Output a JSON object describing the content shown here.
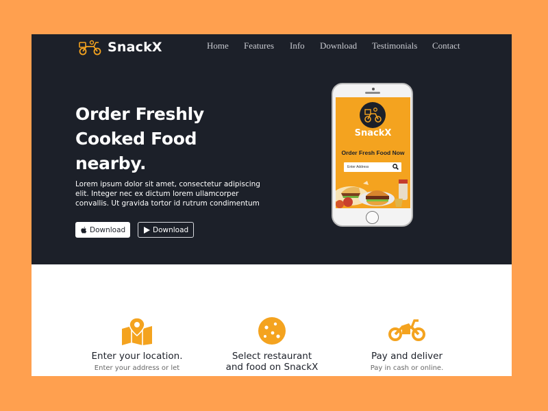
{
  "brand": {
    "name": "SnackX",
    "accent": "#F4A31F",
    "dark": "#1C2029",
    "background": "#FFA04F"
  },
  "nav": {
    "items": [
      "Home",
      "Features",
      "Info",
      "Download",
      "Testimonials",
      "Contact"
    ]
  },
  "hero": {
    "headline_lines": [
      "Order Freshly",
      "Cooked Food",
      "nearby."
    ],
    "description_lines": [
      "Lorem ipsum dolor sit amet, consectetur adipiscing",
      "elit. Integer nec ex dictum lorem ullamcorper",
      "convallis. Ut gravida tortor id rutrum condimentum"
    ],
    "buttons": [
      {
        "label": "Download",
        "icon": "apple-icon"
      },
      {
        "label": "Download",
        "icon": "play-store-icon"
      }
    ]
  },
  "phone_app": {
    "app_name": "SnackX",
    "tagline": "Order Fresh Food Now",
    "search_placeholder": "Enter Address",
    "search_icon": "search-icon"
  },
  "features": [
    {
      "icon": "map-pin-icon",
      "title_lines": [
        "Enter your location."
      ],
      "description": "Enter your address or let"
    },
    {
      "icon": "cookie-icon",
      "title_lines": [
        "Select restaurant",
        "and food on SnackX"
      ],
      "description": ""
    },
    {
      "icon": "motorbike-icon",
      "title_lines": [
        "Pay and deliver"
      ],
      "description": "Pay in cash or online."
    }
  ]
}
